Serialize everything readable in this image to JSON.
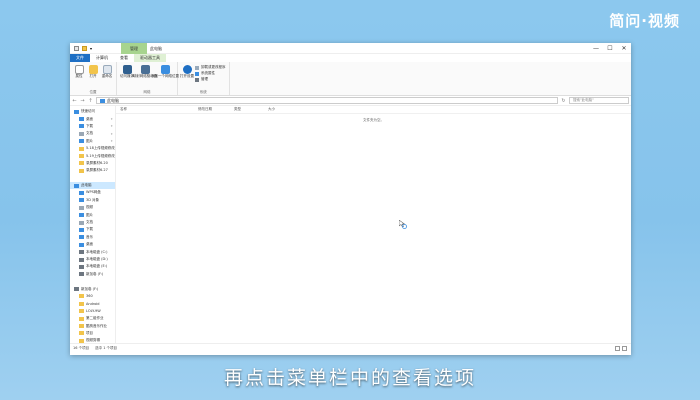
{
  "brand": "简问·视频",
  "caption": "再点击菜单栏中的查看选项",
  "window": {
    "context_group": "管理",
    "title": "此电脑",
    "controls": {
      "minimize": "—",
      "maximize": "☐",
      "close": "✕"
    }
  },
  "tabs": [
    "文件",
    "计算机",
    "查看",
    "驱动器工具"
  ],
  "ribbon": {
    "groups": [
      {
        "label": "位置",
        "buttons": [
          "属性",
          "打开",
          "重命名"
        ]
      },
      {
        "label": "网络",
        "buttons": [
          "访问媒体",
          "映射网络驱动器",
          "添加一个网络位置"
        ]
      },
      {
        "label": "系统",
        "buttons": [
          "打开设置"
        ],
        "small": [
          "卸载或更改程序",
          "系统属性",
          "管理"
        ]
      }
    ]
  },
  "address": {
    "back": "←",
    "forward": "→",
    "up": "↑",
    "path": "此电脑",
    "refresh": "↻",
    "search_placeholder": "搜索\"此电脑\""
  },
  "nav": {
    "items": [
      {
        "label": "快速访问",
        "level": 0,
        "icon": "star-icon",
        "color": "#3b8ee0"
      },
      {
        "label": "桌面",
        "level": 1,
        "icon": "desktop-icon",
        "color": "#3b8ee0",
        "pinned": "✦"
      },
      {
        "label": "下载",
        "level": 1,
        "icon": "download-icon",
        "color": "#3b8ee0",
        "pinned": "✦"
      },
      {
        "label": "文档",
        "level": 1,
        "icon": "document-icon",
        "color": "#9aa7b4",
        "pinned": "✦"
      },
      {
        "label": "图片",
        "level": 1,
        "icon": "picture-icon",
        "color": "#3b8ee0",
        "pinned": "✦"
      },
      {
        "label": "5.18上传视频修改",
        "level": 1,
        "icon": "folder-icon",
        "color": "#f2c44b"
      },
      {
        "label": "5.19上传视频修改",
        "level": 1,
        "icon": "folder-icon",
        "color": "#f2c44b"
      },
      {
        "label": "录屏素材6.20",
        "level": 1,
        "icon": "folder-icon",
        "color": "#f2c44b"
      },
      {
        "label": "录屏素材6.27",
        "level": 1,
        "icon": "folder-icon",
        "color": "#f2c44b"
      },
      {
        "label": "",
        "level": 0,
        "icon": "spacer",
        "color": "#ffffff"
      },
      {
        "label": "此电脑",
        "level": 0,
        "icon": "computer-icon",
        "color": "#3b8ee0",
        "selected": true
      },
      {
        "label": "WPS网盘",
        "level": 1,
        "icon": "cloud-icon",
        "color": "#3b8ee0"
      },
      {
        "label": "3D 对象",
        "level": 1,
        "icon": "cube-icon",
        "color": "#3b8ee0"
      },
      {
        "label": "视频",
        "level": 1,
        "icon": "video-icon",
        "color": "#9aa7b4"
      },
      {
        "label": "图片",
        "level": 1,
        "icon": "picture-icon",
        "color": "#3b8ee0"
      },
      {
        "label": "文档",
        "level": 1,
        "icon": "document-icon",
        "color": "#9aa7b4"
      },
      {
        "label": "下载",
        "level": 1,
        "icon": "download-icon",
        "color": "#3b8ee0"
      },
      {
        "label": "音乐",
        "level": 1,
        "icon": "music-icon",
        "color": "#3b8ee0"
      },
      {
        "label": "桌面",
        "level": 1,
        "icon": "desktop-icon",
        "color": "#3b8ee0"
      },
      {
        "label": "本地磁盘 (C:)",
        "level": 1,
        "icon": "drive-icon",
        "color": "#6d7680"
      },
      {
        "label": "本地磁盘 (D:)",
        "level": 1,
        "icon": "drive-icon",
        "color": "#6d7680"
      },
      {
        "label": "本地磁盘 (E:)",
        "level": 1,
        "icon": "drive-icon",
        "color": "#6d7680"
      },
      {
        "label": "新加卷 (F:)",
        "level": 1,
        "icon": "drive-icon",
        "color": "#6d7680"
      },
      {
        "label": "",
        "level": 0,
        "icon": "spacer",
        "color": "#ffffff"
      },
      {
        "label": "新加卷 (F:)",
        "level": 0,
        "icon": "drive-icon",
        "color": "#6d7680"
      },
      {
        "label": "360",
        "level": 1,
        "icon": "folder-icon",
        "color": "#f2c44b"
      },
      {
        "label": "Android",
        "level": 1,
        "icon": "folder-icon",
        "color": "#f2c44b"
      },
      {
        "label": "LOLY-9W",
        "level": 1,
        "icon": "folder-icon",
        "color": "#f2c44b"
      },
      {
        "label": "第二组作业",
        "level": 1,
        "icon": "folder-icon",
        "color": "#f2c44b"
      },
      {
        "label": "酷狗音乐作业",
        "level": 1,
        "icon": "folder-icon",
        "color": "#f2c44b"
      },
      {
        "label": "项目",
        "level": 1,
        "icon": "folder-icon",
        "color": "#f2c44b"
      },
      {
        "label": "视频剪辑",
        "level": 1,
        "icon": "folder-icon",
        "color": "#f2c44b"
      },
      {
        "label": "未读工作",
        "level": 1,
        "icon": "folder-icon",
        "color": "#f2c44b"
      },
      {
        "label": "",
        "level": 0,
        "icon": "spacer",
        "color": "#ffffff"
      },
      {
        "label": "网络",
        "level": 0,
        "icon": "network-icon",
        "color": "#3b8ee0"
      }
    ]
  },
  "columns": [
    "名称",
    "修改日期",
    "类型",
    "大小"
  ],
  "empty_text": "文件夹为空。",
  "status": {
    "count": "16 个项目",
    "selection": "选中 1 个项目"
  }
}
